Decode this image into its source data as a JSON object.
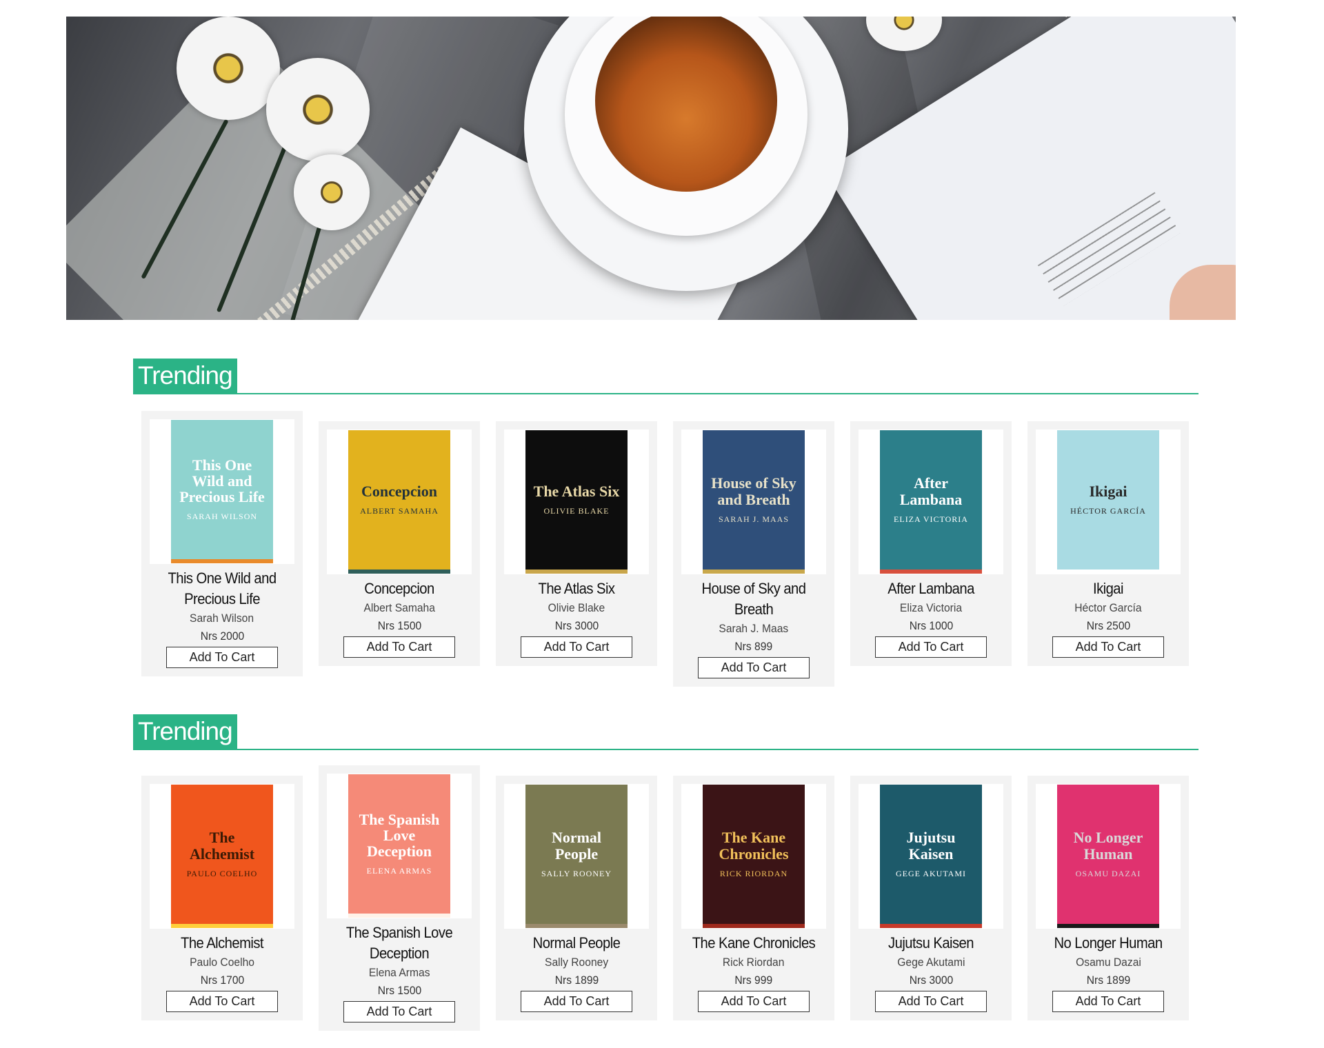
{
  "sections": [
    {
      "title": "Trending",
      "books": [
        {
          "title": "This One Wild and Precious Life",
          "author": "Sarah Wilson",
          "price": "Nrs 2000",
          "button": "Add To Cart",
          "cover": {
            "bg": "#8fd3cf",
            "fg": "#ffffff",
            "accent": "#e98a2a"
          }
        },
        {
          "title": "Concepcion",
          "author": "Albert Samaha",
          "price": "Nrs 1500",
          "button": "Add To Cart",
          "cover": {
            "bg": "#e2b21e",
            "fg": "#23323a",
            "accent": "#2f5f5a"
          }
        },
        {
          "title": "The Atlas Six",
          "author": "Olivie Blake",
          "price": "Nrs 3000",
          "button": "Add To Cart",
          "cover": {
            "bg": "#0d0d0d",
            "fg": "#e9d9a8",
            "accent": "#c9a64b"
          }
        },
        {
          "title": "House of Sky and Breath",
          "author": "Sarah J. Maas",
          "price": "Nrs 899",
          "button": "Add To Cart",
          "cover": {
            "bg": "#2f4f7a",
            "fg": "#e8e2c9",
            "accent": "#c9a84b"
          }
        },
        {
          "title": "After Lambana",
          "author": "Eliza Victoria",
          "price": "Nrs 1000",
          "button": "Add To Cart",
          "cover": {
            "bg": "#2c7f8a",
            "fg": "#ffffff",
            "accent": "#d8503d"
          }
        },
        {
          "title": "Ikigai",
          "author": "Héctor García",
          "price": "Nrs 2500",
          "button": "Add To Cart",
          "cover": {
            "bg": "#a9dbe3",
            "fg": "#2a2a2a",
            "accent": "#ffffff"
          }
        }
      ]
    },
    {
      "title": "Trending",
      "books": [
        {
          "title": "The Alchemist",
          "author": "Paulo Coelho",
          "price": "Nrs 1700",
          "button": "Add To Cart",
          "cover": {
            "bg": "#f0561d",
            "fg": "#3a1a05",
            "accent": "#ffce3a"
          }
        },
        {
          "title": "The Spanish Love Deception",
          "author": "Elena Armas",
          "price": "Nrs 1500",
          "button": "Add To Cart",
          "cover": {
            "bg": "#f58a78",
            "fg": "#ffffff",
            "accent": "#fff2e8"
          }
        },
        {
          "title": "Normal People",
          "author": "Sally Rooney",
          "price": "Nrs 1899",
          "button": "Add To Cart",
          "cover": {
            "bg": "#7b7a52",
            "fg": "#ffffff",
            "accent": "#9a8a6c"
          }
        },
        {
          "title": "The Kane Chronicles",
          "author": "Rick Riordan",
          "price": "Nrs 999",
          "button": "Add To Cart",
          "cover": {
            "bg": "#3b1416",
            "fg": "#f2c15a",
            "accent": "#9f2a1d"
          }
        },
        {
          "title": "Jujutsu Kaisen",
          "author": "Gege Akutami",
          "price": "Nrs 3000",
          "button": "Add To Cart",
          "cover": {
            "bg": "#1d5a6a",
            "fg": "#ffffff",
            "accent": "#c83a2a"
          }
        },
        {
          "title": "No Longer Human",
          "author": "Osamu Dazai",
          "price": "Nrs 1899",
          "button": "Add To Cart",
          "cover": {
            "bg": "#e0326f",
            "fg": "#d9d9d9",
            "accent": "#1a1a1a"
          }
        }
      ]
    }
  ]
}
